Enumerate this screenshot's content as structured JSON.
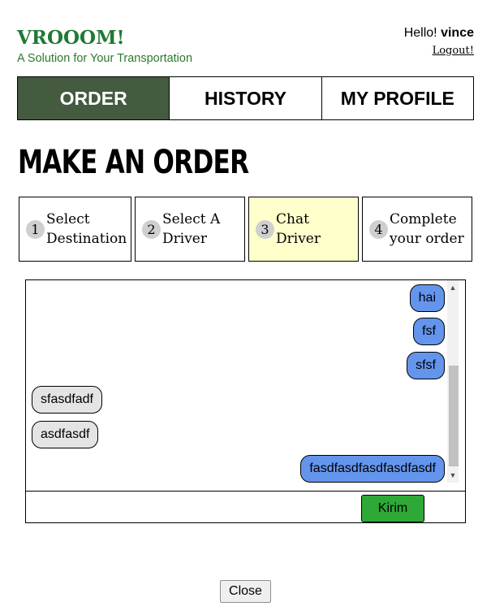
{
  "brand": {
    "title": "VROOOM!",
    "tagline": "A Solution for Your Transportation"
  },
  "user": {
    "greeting": "Hello!",
    "name": "vince",
    "logout_label": "Logout!"
  },
  "nav": {
    "items": [
      {
        "label": "ORDER"
      },
      {
        "label": "HISTORY"
      },
      {
        "label": "MY PROFILE"
      }
    ],
    "active": "ORDER"
  },
  "page_title": "MAKE AN ORDER",
  "steps": [
    {
      "num": "1",
      "label": "Select Destination"
    },
    {
      "num": "2",
      "label": "Select A Driver"
    },
    {
      "num": "3",
      "label": "Chat Driver"
    },
    {
      "num": "4",
      "label": "Complete your order"
    }
  ],
  "active_step": "3",
  "chat": {
    "messages": [
      {
        "text": "hai",
        "from": "me"
      },
      {
        "text": "fsf",
        "from": "me"
      },
      {
        "text": "sfsf",
        "from": "me"
      },
      {
        "text": "sfasdfadf",
        "from": "driver"
      },
      {
        "text": "asdfasdf",
        "from": "driver"
      },
      {
        "text": "fasdfasdfasdfasdfasdf",
        "from": "me"
      }
    ],
    "input_value": "",
    "send_label": "Kirim"
  },
  "close_label": "Close",
  "colors": {
    "brand": "#1f7a34",
    "nav_active": "#445b3f",
    "step_active": "#ffffcc",
    "sent_bubble": "#6495ed",
    "received_bubble": "#e4e4e4",
    "send_button": "#2ea836"
  }
}
